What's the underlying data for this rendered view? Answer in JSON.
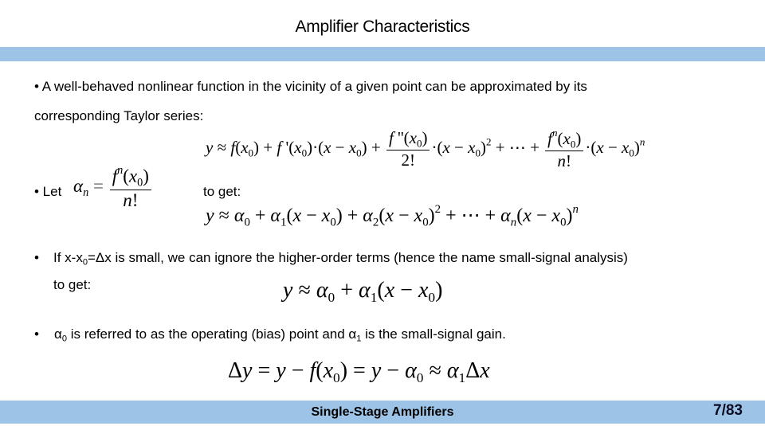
{
  "slide": {
    "title": "Amplifier Characteristics",
    "band_color": "#9dc3e6"
  },
  "content": {
    "bullet1_line1": "• A well-behaved nonlinear function in the vicinity of a given point can be approximated by its",
    "bullet1_line2": "corresponding Taylor series:",
    "taylor_series": {
      "lhs": "y ≈ f(x₀) + f'(x₀)·(x − x₀) + f''(x₀)/2! ·(x − x₀)² + ⋯ + fⁿ(x₀)/n! ·(x − x₀)ⁿ"
    },
    "bullet2_prefix": "• Let",
    "alpha_definition": "αₙ = fⁿ(x₀)/n!",
    "bullet2_suffix": "to get:",
    "alpha_series": "y ≈ α₀ + α₁(x − x₀) + α₂(x − x₀)² + ⋯ + αₙ(x − x₀)ⁿ",
    "bullet3_bullet": "•",
    "bullet3_line1_a": "If x-x",
    "bullet3_line1_sub": "0",
    "bullet3_line1_b": "=Δx is small, we can ignore the higher-order terms (hence the name small-signal analysis)",
    "bullet3_line2": "to get:",
    "linear_approx": "y ≈ α₀ + α₁(x − x₀)",
    "bullet4_bullet": "•",
    "bullet4_alpha0": "α",
    "bullet4_sub0": "0",
    "bullet4_mid": " is referred to as the operating (bias) point and α",
    "bullet4_sub1": "1",
    "bullet4_end": " is the small-signal gain.",
    "delta_equation": "Δy = y − f(x₀) = y − α₀ ≈ α₁Δx"
  },
  "footer": {
    "title": "Single-Stage Amplifiers",
    "page": "7/83"
  }
}
